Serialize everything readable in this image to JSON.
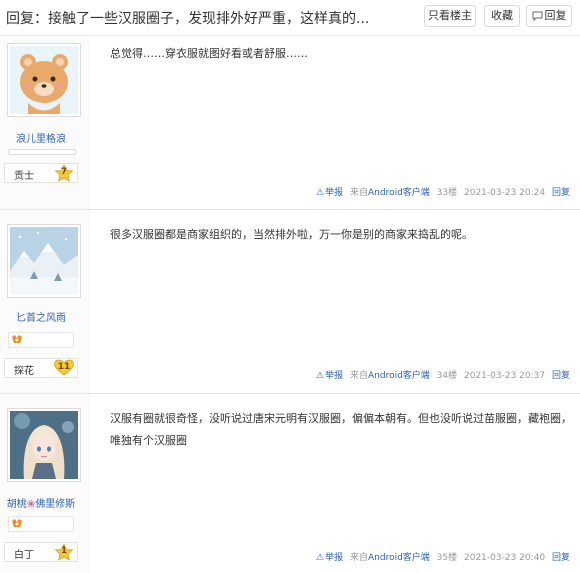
{
  "header": {
    "title": "回复：接触了一些汉服圈子，发现排外好严重，这样真的...",
    "only_host_label": "只看楼主",
    "favorite_label": "收藏",
    "reply_label": "回复"
  },
  "posts": [
    {
      "username": "浪儿里格浪",
      "rank_title": "贡士",
      "rank_level": "7",
      "content": "总觉得……穿衣服就图好看或者舒服……",
      "report": "举报",
      "source_prefix": "来自",
      "source_client": "Android客户端",
      "floor": "33楼",
      "time": "2021-03-23 20:24",
      "reply": "回复",
      "avatar": "bear-avatar"
    },
    {
      "username": "匕首之风雨",
      "rank_title": "探花",
      "rank_level": "11",
      "content": "很多汉服圈都是商家组织的，当然排外啦，万一你是别的商家来捣乱的呢。",
      "report": "举报",
      "source_prefix": "来自",
      "source_client": "Android客户端",
      "floor": "34楼",
      "time": "2021-03-23 20:37",
      "reply": "回复",
      "avatar": "snow-landscape-avatar",
      "medal": "fan-medal-icon"
    },
    {
      "username_a": "胡桃",
      "username_sep": "❀",
      "username_b": "佛里修斯",
      "rank_title": "白丁",
      "rank_level": "1",
      "content": "汉服有圈就很奇怪，没听说过唐宋元明有汉服圈，偏偏本朝有。但也没听说过苗服圈，藏袍圈，唯独有个汉服圈",
      "report": "举报",
      "source_prefix": "来自",
      "source_client": "Android客户端",
      "floor": "35楼",
      "time": "2021-03-23 20:40",
      "reply": "回复",
      "avatar": "anime-girl-avatar",
      "medal": "fan-medal-icon"
    }
  ],
  "colors": {
    "link": "#2d64b3",
    "meta": "#999999",
    "sidebar": "#fbfbfb",
    "badge": "#f3c83a"
  }
}
